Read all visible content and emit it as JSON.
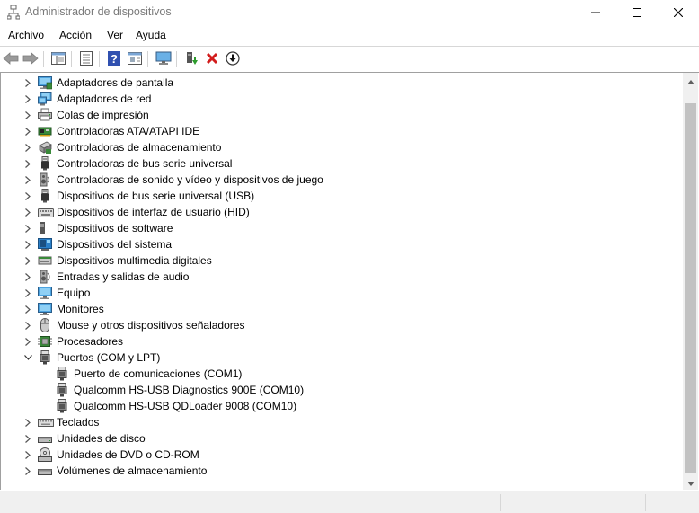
{
  "window": {
    "title": "Administrador de dispositivos",
    "controls": [
      "minimize",
      "maximize",
      "close"
    ]
  },
  "menu": [
    "Archivo",
    "Acción",
    "Ver",
    "Ayuda"
  ],
  "toolbar": {
    "buttons": [
      "back-icon",
      "forward-icon",
      "properties-pane-icon",
      "list-icon",
      "help-icon",
      "view-icon",
      "monitor-icon",
      "update-driver-icon",
      "uninstall-icon",
      "download-icon"
    ]
  },
  "tree": {
    "items": [
      {
        "label": "Adaptadores de pantalla",
        "icon": "display-adapter-icon",
        "expanded": false,
        "level": 0
      },
      {
        "label": "Adaptadores de red",
        "icon": "network-adapter-icon",
        "expanded": false,
        "level": 0
      },
      {
        "label": "Colas de impresión",
        "icon": "printer-icon",
        "expanded": false,
        "level": 0
      },
      {
        "label": "Controladoras ATA/ATAPI IDE",
        "icon": "ide-controller-icon",
        "expanded": false,
        "level": 0
      },
      {
        "label": "Controladoras de almacenamiento",
        "icon": "storage-controller-icon",
        "expanded": false,
        "level": 0
      },
      {
        "label": "Controladoras de bus serie universal",
        "icon": "usb-icon",
        "expanded": false,
        "level": 0
      },
      {
        "label": "Controladoras de sonido y vídeo y dispositivos de juego",
        "icon": "sound-icon",
        "expanded": false,
        "level": 0
      },
      {
        "label": "Dispositivos de bus serie universal (USB)",
        "icon": "usb-icon",
        "expanded": false,
        "level": 0
      },
      {
        "label": "Dispositivos de interfaz de usuario (HID)",
        "icon": "hid-icon",
        "expanded": false,
        "level": 0
      },
      {
        "label": "Dispositivos de software",
        "icon": "software-device-icon",
        "expanded": false,
        "level": 0
      },
      {
        "label": "Dispositivos del sistema",
        "icon": "system-device-icon",
        "expanded": false,
        "level": 0
      },
      {
        "label": "Dispositivos multimedia digitales",
        "icon": "multimedia-icon",
        "expanded": false,
        "level": 0
      },
      {
        "label": "Entradas y salidas de audio",
        "icon": "audio-icon",
        "expanded": false,
        "level": 0
      },
      {
        "label": "Equipo",
        "icon": "computer-icon",
        "expanded": false,
        "level": 0
      },
      {
        "label": "Monitores",
        "icon": "monitor-icon",
        "expanded": false,
        "level": 0
      },
      {
        "label": "Mouse y otros dispositivos señaladores",
        "icon": "mouse-icon",
        "expanded": false,
        "level": 0
      },
      {
        "label": "Procesadores",
        "icon": "processor-icon",
        "expanded": false,
        "level": 0
      },
      {
        "label": "Puertos (COM y LPT)",
        "icon": "port-icon",
        "expanded": true,
        "level": 0
      },
      {
        "label": "Puerto de comunicaciones (COM1)",
        "icon": "port-icon",
        "expanded": null,
        "level": 1
      },
      {
        "label": "Qualcomm HS-USB Diagnostics 900E (COM10)",
        "icon": "port-icon",
        "expanded": null,
        "level": 1
      },
      {
        "label": "Qualcomm HS-USB QDLoader 9008 (COM10)",
        "icon": "port-icon",
        "expanded": null,
        "level": 1
      },
      {
        "label": "Teclados",
        "icon": "keyboard-icon",
        "expanded": false,
        "level": 0
      },
      {
        "label": "Unidades de disco",
        "icon": "disk-drive-icon",
        "expanded": false,
        "level": 0
      },
      {
        "label": "Unidades de DVD o CD-ROM",
        "icon": "dvd-icon",
        "expanded": false,
        "level": 0
      },
      {
        "label": "Volúmenes de almacenamiento",
        "icon": "storage-volume-icon",
        "expanded": false,
        "level": 0
      }
    ]
  },
  "statusbar": {
    "text": ""
  }
}
